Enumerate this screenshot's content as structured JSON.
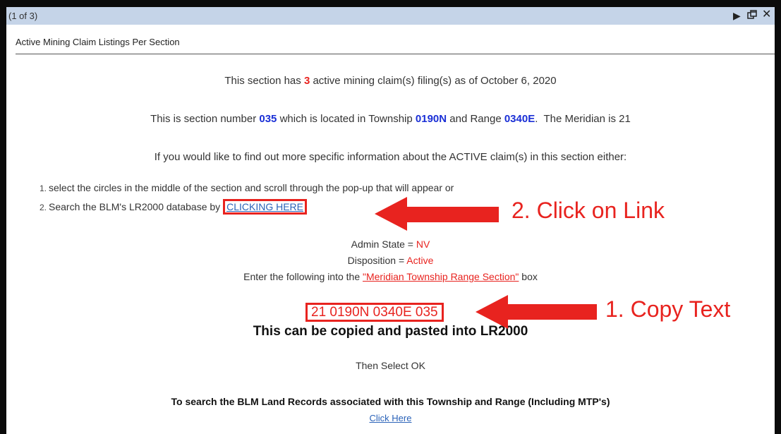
{
  "titlebar": {
    "counter": "(1 of 3)",
    "next_icon": "play-triangle-icon",
    "dock_icon": "dock-window-icon",
    "close_icon": "close-x-icon"
  },
  "popup": {
    "title": "Active Mining Claim Listings Per Section",
    "line1": {
      "pre": "This section has ",
      "count": "3",
      "post": " active mining claim(s) filing(s) as of October 6, 2020"
    },
    "line2": {
      "pre": "This is section number ",
      "section": "035",
      "mid1": " which is located in Township ",
      "township": "0190N",
      "mid2": " and Range ",
      "range": "0340E",
      "post": ".  The Meridian is 21"
    },
    "line3": "If you would like to find out more specific information about the ACTIVE claim(s) in this section either:",
    "step1": {
      "num": "1.",
      "text": "select the circles in the middle of the section and scroll through the pop-up that will appear or"
    },
    "step2": {
      "num": "2.",
      "text": "Search the BLM's LR2000 database by ",
      "link": "CLICKING HERE"
    },
    "admin_state": {
      "label": "Admin State = ",
      "value": "NV"
    },
    "disposition": {
      "label": "Disposition = ",
      "value": "Active"
    },
    "enter_line": {
      "pre": "Enter the following into the ",
      "link": "\"Meridian Township Range Section\"",
      "post": " box"
    },
    "mtrs_text": "21 0190N 0340E 035",
    "copy_note": "This can be copied and pasted into LR2000",
    "then_select": "Then Select OK",
    "land_records": "To search the BLM Land Records associated with this Township and Range (Including MTP's)",
    "click_here": "Click Here"
  },
  "annotations": {
    "click_link": "2. Click on Link",
    "copy_text": "1. Copy Text"
  },
  "colors": {
    "accent_red": "#e8231f",
    "number_blue": "#1a2fd6",
    "link_blue": "#2a62b8",
    "titlebar": "#c5d4e8"
  }
}
